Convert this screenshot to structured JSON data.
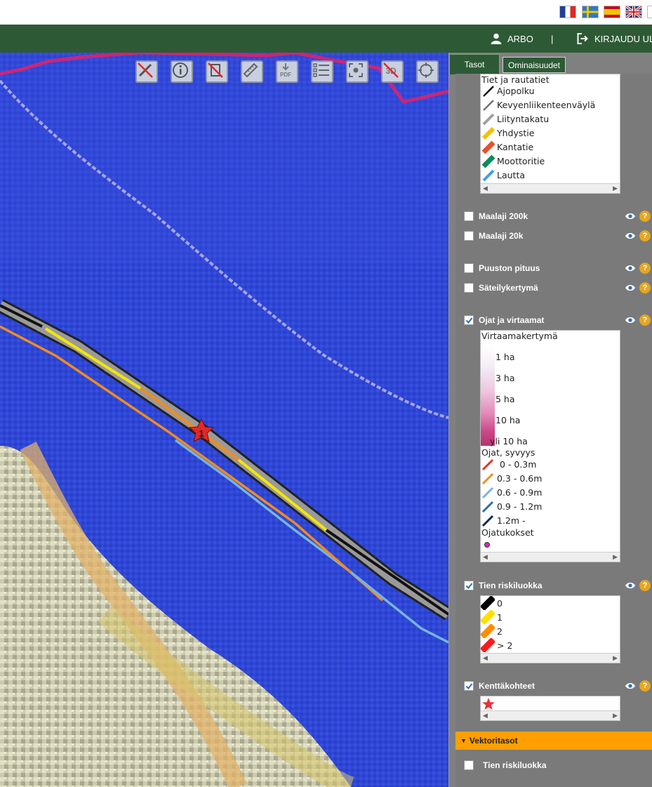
{
  "topbar": {
    "flags": [
      {
        "name": "french-flag",
        "lang": "fr"
      },
      {
        "name": "swedish-flag",
        "lang": "sv"
      },
      {
        "name": "spanish-flag",
        "lang": "es"
      },
      {
        "name": "uk-flag",
        "lang": "en"
      }
    ]
  },
  "header": {
    "user_label": "ARBO",
    "separator": "|",
    "logout_label": "KIRJAUDU ULOS",
    "bg_color": "#2d5a35"
  },
  "map": {
    "tools": [
      "disabled-draw-tool",
      "info-tool",
      "disabled-edit-tool",
      "measure-tool",
      "pdf-tool",
      "legend-tool",
      "fullscreen-tool",
      "disabled-3d-tool",
      "locate-tool"
    ],
    "tool_labels": {
      "pdf": "PDF",
      "three_d": "3D"
    },
    "marker_label": "1"
  },
  "panel": {
    "tabs": [
      {
        "label": "Tasot",
        "active": false
      },
      {
        "label": "Ominaisuudet",
        "active": true
      }
    ],
    "roads_legend": {
      "title": "Tiet ja rautatiet",
      "items": [
        {
          "label": "Ajopolku",
          "color": "#111111"
        },
        {
          "label": "Kevyenliikenteenväylä",
          "color": "#707070"
        },
        {
          "label": "Liityntakatu",
          "color": "#a0a0a0"
        },
        {
          "label": "Yhdystie",
          "color": "#f5c200"
        },
        {
          "label": "Kantatie",
          "color": "#e4532c"
        },
        {
          "label": "Moottoritie",
          "color": "#0f8a5a"
        },
        {
          "label": "Lautta",
          "color": "#3fa0e8"
        }
      ]
    },
    "layers": {
      "maalaji200k": {
        "label": "Maalaji 200k",
        "checked": false
      },
      "maalaji20k": {
        "label": "Maalaji 20k",
        "checked": false
      },
      "puuston": {
        "label": "Puuston pituus",
        "checked": false
      },
      "sateily": {
        "label": "Säteilykertymä",
        "checked": false
      },
      "ojat": {
        "label": "Ojat ja virtaamat",
        "checked": true
      },
      "riski": {
        "label": "Tien riskiluokka",
        "checked": true
      },
      "kentta": {
        "label": "Kenttäkohteet",
        "checked": true
      }
    },
    "ojat_legend": {
      "flow_title": "Virtaamakertymä",
      "flow_items": [
        "1 ha",
        "3 ha",
        "5 ha",
        "10 ha",
        "yli 10 ha"
      ],
      "depth_title": "Ojat, syvyys",
      "depth_items": [
        {
          "label": " 0 - 0.3m",
          "color": "#e8321e"
        },
        {
          "label": "0.3 - 0.6m",
          "color": "#f08c1e"
        },
        {
          "label": "0.6 - 0.9m",
          "color": "#78b4dc"
        },
        {
          "label": "0.9 - 1.2m",
          "color": "#2d6ea0"
        },
        {
          "label": "1.2m -",
          "color": "#0a2850"
        }
      ],
      "blockage_title": "Ojatukokset"
    },
    "risk_legend": {
      "items": [
        {
          "label": "0",
          "color": "#000000"
        },
        {
          "label": "1",
          "color": "#ffe000"
        },
        {
          "label": "2",
          "color": "#ff8c00"
        },
        {
          "label": "> 2",
          "color": "#ff1a1a"
        }
      ]
    },
    "vector": {
      "header": "Vektoritasot",
      "layer_label": "Tien riskiluokka",
      "layer_checked": false
    }
  }
}
